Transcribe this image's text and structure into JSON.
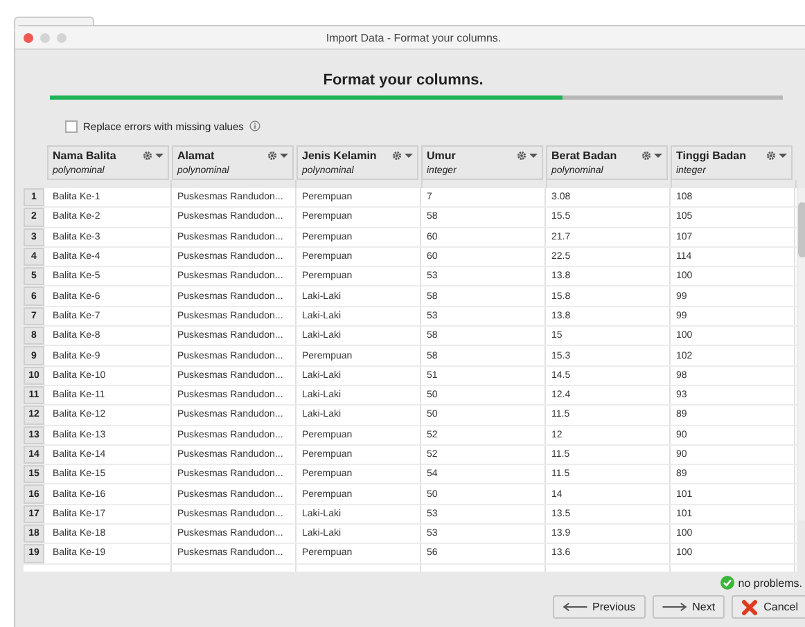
{
  "window": {
    "title": "Import Data - Format your columns."
  },
  "heading": "Format your columns.",
  "progress": {
    "level": 0.7
  },
  "replace_errors": {
    "label": "Replace errors with missing values",
    "checked": false
  },
  "table": {
    "columns": [
      {
        "name": "Nama Balita",
        "type": "polynominal"
      },
      {
        "name": "Alamat",
        "type": "polynominal"
      },
      {
        "name": "Jenis Kelamin",
        "type": "polynominal"
      },
      {
        "name": "Umur",
        "type": "integer"
      },
      {
        "name": "Berat Badan",
        "type": "polynominal"
      },
      {
        "name": "Tinggi Badan",
        "type": "integer"
      }
    ],
    "rows": [
      {
        "index": "1",
        "cells": [
          "Balita Ke-1",
          "Puskesmas Randudon...",
          "Perempuan",
          "7",
          "3.08",
          "108"
        ]
      },
      {
        "index": "2",
        "cells": [
          "Balita Ke-2",
          "Puskesmas Randudon...",
          "Perempuan",
          "58",
          "15.5",
          "105"
        ]
      },
      {
        "index": "3",
        "cells": [
          "Balita Ke-3",
          "Puskesmas Randudon...",
          "Perempuan",
          "60",
          "21.7",
          "107"
        ]
      },
      {
        "index": "4",
        "cells": [
          "Balita Ke-4",
          "Puskesmas Randudon...",
          "Perempuan",
          "60",
          "22.5",
          "114"
        ]
      },
      {
        "index": "5",
        "cells": [
          "Balita Ke-5",
          "Puskesmas Randudon...",
          "Perempuan",
          "53",
          "13.8",
          "100"
        ]
      },
      {
        "index": "6",
        "cells": [
          "Balita Ke-6",
          "Puskesmas Randudon...",
          "Laki-Laki",
          "58",
          "15.8",
          "99"
        ]
      },
      {
        "index": "7",
        "cells": [
          "Balita Ke-7",
          "Puskesmas Randudon...",
          "Laki-Laki",
          "53",
          "13.8",
          "99"
        ]
      },
      {
        "index": "8",
        "cells": [
          "Balita Ke-8",
          "Puskesmas Randudon...",
          "Laki-Laki",
          "58",
          "15",
          "100"
        ]
      },
      {
        "index": "9",
        "cells": [
          "Balita Ke-9",
          "Puskesmas Randudon...",
          "Perempuan",
          "58",
          "15.3",
          "102"
        ]
      },
      {
        "index": "10",
        "cells": [
          "Balita Ke-10",
          "Puskesmas Randudon...",
          "Laki-Laki",
          "51",
          "14.5",
          "98"
        ]
      },
      {
        "index": "11",
        "cells": [
          "Balita Ke-11",
          "Puskesmas Randudon...",
          "Laki-Laki",
          "50",
          "12.4",
          "93"
        ]
      },
      {
        "index": "12",
        "cells": [
          "Balita Ke-12",
          "Puskesmas Randudon...",
          "Laki-Laki",
          "50",
          "11.5",
          "89"
        ]
      },
      {
        "index": "13",
        "cells": [
          "Balita Ke-13",
          "Puskesmas Randudon...",
          "Perempuan",
          "52",
          "12",
          "90"
        ]
      },
      {
        "index": "14",
        "cells": [
          "Balita Ke-14",
          "Puskesmas Randudon...",
          "Perempuan",
          "52",
          "11.5",
          "90"
        ]
      },
      {
        "index": "15",
        "cells": [
          "Balita Ke-15",
          "Puskesmas Randudon...",
          "Perempuan",
          "54",
          "11.5",
          "89"
        ]
      },
      {
        "index": "16",
        "cells": [
          "Balita Ke-16",
          "Puskesmas Randudon...",
          "Perempuan",
          "50",
          "14",
          "101"
        ]
      },
      {
        "index": "17",
        "cells": [
          "Balita Ke-17",
          "Puskesmas Randudon...",
          "Laki-Laki",
          "53",
          "13.5",
          "101"
        ]
      },
      {
        "index": "18",
        "cells": [
          "Balita Ke-18",
          "Puskesmas Randudon...",
          "Laki-Laki",
          "53",
          "13.9",
          "100"
        ]
      },
      {
        "index": "19",
        "cells": [
          "Balita Ke-19",
          "Puskesmas Randudon...",
          "Perempuan",
          "56",
          "13.6",
          "100"
        ]
      }
    ]
  },
  "status": "no problems.",
  "buttons": [
    {
      "kind": "previous",
      "label": "Previous"
    },
    {
      "kind": "next",
      "label": "Next"
    },
    {
      "kind": "cancel",
      "label": "Cancel"
    }
  ]
}
